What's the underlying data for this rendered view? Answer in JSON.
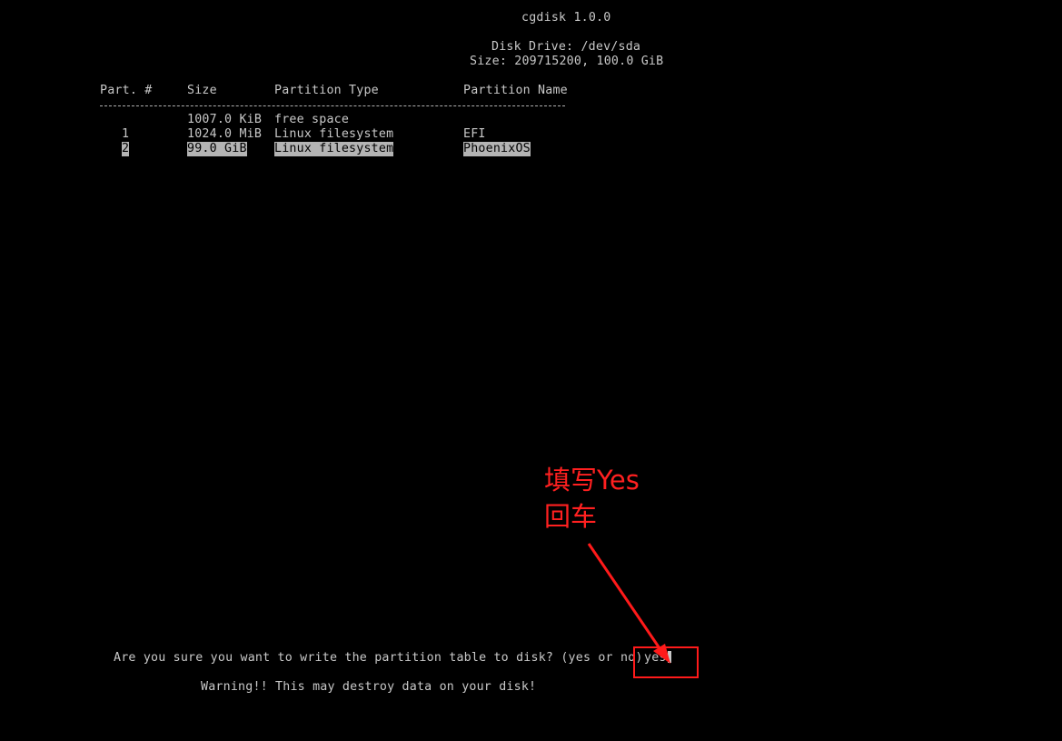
{
  "header": {
    "program": "cgdisk 1.0.0",
    "disk_drive": "Disk Drive: /dev/sda",
    "disk_size": "Size: 209715200, 100.0 GiB"
  },
  "table": {
    "columns": [
      "Part. #",
      "Size",
      "Partition Type",
      "Partition Name"
    ],
    "rows": [
      {
        "num": "",
        "size": "1007.0 KiB",
        "type": "free space",
        "name": ""
      },
      {
        "num": "1",
        "size": "1024.0 MiB",
        "type": "Linux filesystem",
        "name": "EFI"
      },
      {
        "num": "2",
        "size": "99.0 GiB",
        "type": "Linux filesystem",
        "name": "PhoenixOS",
        "selected": true
      }
    ]
  },
  "prompt": {
    "question": "Are you sure you want to write the partition table to disk? (yes or no)",
    "answer": "yes",
    "warning": "Warning!! This may destroy data on your disk!"
  },
  "annotation": {
    "line1": "填写Yes",
    "line2": "回车",
    "color": "#ff2020"
  }
}
